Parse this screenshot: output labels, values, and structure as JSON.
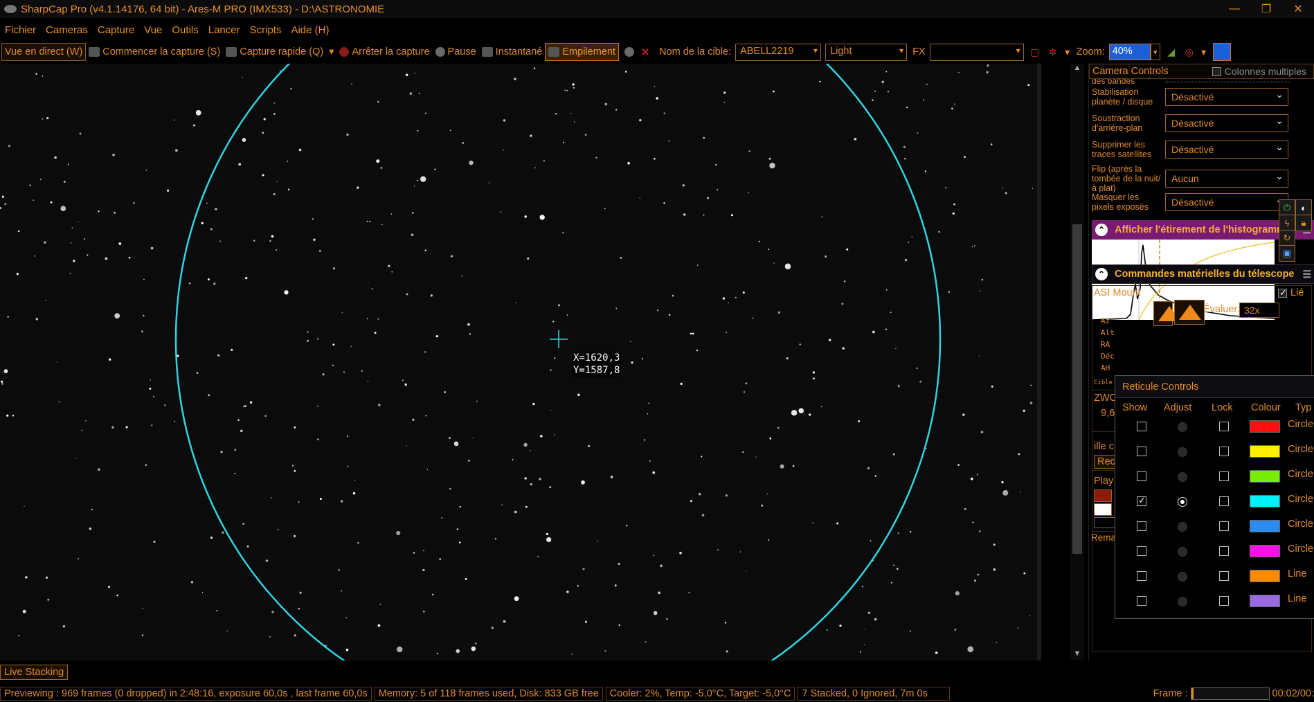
{
  "window": {
    "title": "SharpCap Pro (v4.1.14176, 64 bit) - Ares-M PRO (IMX533) - D:\\ASTRONOMIE"
  },
  "menu": [
    "Fichier",
    "Cameras",
    "Capture",
    "Vue",
    "Outils",
    "Lancer",
    "Scripts",
    "Aide (H)"
  ],
  "toolbar": {
    "live_view": "Vue en direct (W)",
    "start_capture": "Commencer la capture (S)",
    "quick_capture": "Capture rapide (Q)",
    "stop_capture": "Arrêter la capture",
    "pause": "Pause",
    "snapshot": "Instantané",
    "stacking": "Empilement",
    "target_label": "Nom de la cible:",
    "target_value": "ABELL2219",
    "frame_type": "Light",
    "fx_label": "FX",
    "fx_value": "",
    "zoom_label": "Zoom:",
    "zoom_value": "40%"
  },
  "viewport": {
    "coords_x": "X=1620,3",
    "coords_y": "Y=1587,8",
    "reticle_color": "#2fd4e0"
  },
  "panel": {
    "header": "Camera Controls",
    "multi_columns": "Colonnes multiples",
    "truncated_top": "des bandes",
    "rows": [
      {
        "label": "Stabilisation planète / disque",
        "value": "Désactivé"
      },
      {
        "label": "Soustraction d'arrière-plan",
        "value": "Désactivé"
      },
      {
        "label": "Supprimer les traces satellites",
        "value": "Désactivé"
      },
      {
        "label": "Flip (après la tombée de la nuit/à plat)",
        "value": "Aucun"
      },
      {
        "label": "Masquer les pixels exposés",
        "value": "Désactivé"
      }
    ],
    "histogram_title": "Afficher l'étirement de l'histogramme",
    "telescope_title": "Commandes matérielles du télescope",
    "mount_name": "ASI Mount",
    "linked_label": "Lié",
    "evaluate_label": "Évaluer:",
    "evaluate_value": "32x",
    "axes": [
      "Az",
      "Alt",
      "RA",
      "Déc",
      "AH"
    ],
    "cible_label": "Cible :",
    "zwo_label": "ZWO",
    "zwo_value": "9,6",
    "ille_label": "ille c",
    "rec_label": "Rec",
    "play_label": "Play",
    "zero_label": "0",
    "remarks_label": "Remarques"
  },
  "reticule": {
    "title": "Reticule Controls",
    "headers": {
      "show": "Show",
      "adjust": "Adjust",
      "lock": "Lock",
      "colour": "Colour",
      "type": "Typ"
    },
    "rows": [
      {
        "show": false,
        "adjust": false,
        "color": "#ff1010",
        "type": "Circle"
      },
      {
        "show": false,
        "adjust": false,
        "color": "#ffee00",
        "type": "Circle"
      },
      {
        "show": false,
        "adjust": false,
        "color": "#77ee00",
        "type": "Circle"
      },
      {
        "show": true,
        "adjust": true,
        "color": "#00f0f8",
        "type": "Circle"
      },
      {
        "show": false,
        "adjust": false,
        "color": "#2a8cf0",
        "type": "Circle"
      },
      {
        "show": false,
        "adjust": false,
        "color": "#ff10e8",
        "type": "Circle"
      },
      {
        "show": false,
        "adjust": false,
        "color": "#ff8a00",
        "type": "Line"
      },
      {
        "show": false,
        "adjust": false,
        "color": "#9a6ae0",
        "type": "Line"
      }
    ]
  },
  "status": {
    "live_stacking": "Live Stacking",
    "preview": "Previewing : 969 frames (0 dropped) in 2:48:16, exposure 60,0s , last frame 60,0s",
    "memory": "Memory: 5 of 118 frames used, Disk: 833 GB free",
    "cooler": "Cooler: 2%, Temp: -5,0°C, Target: -5,0°C",
    "stacked": "7 Stacked, 0 Ignored, 7m 0s",
    "frame_label": "Frame :",
    "frame_time": "00:02/00:",
    "frame_progress": 0.03
  }
}
